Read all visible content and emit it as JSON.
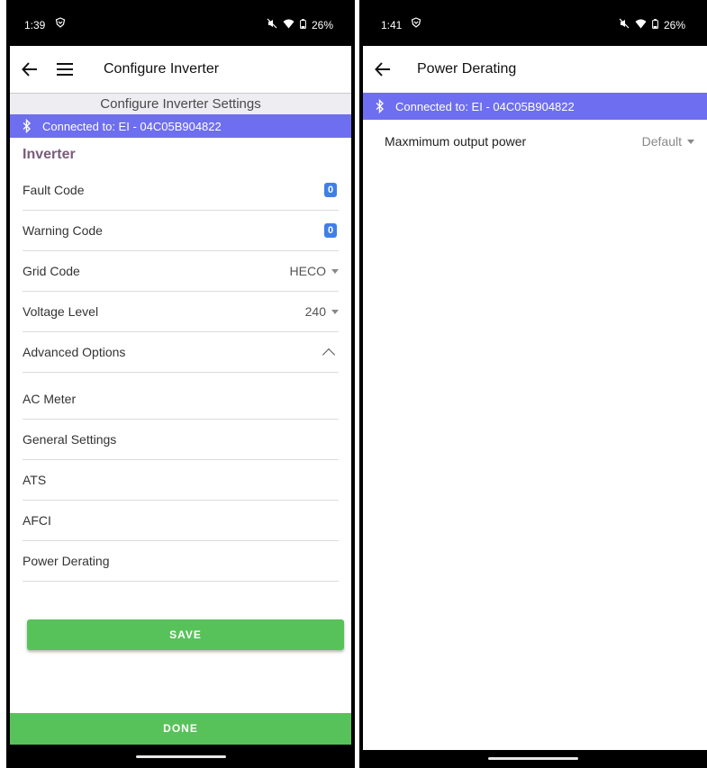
{
  "left": {
    "status": {
      "time": "1:39",
      "battery": "26%"
    },
    "appbar": {
      "title": "Configure Inverter"
    },
    "subtitle": "Configure Inverter Settings",
    "connected": "Connected to: EI - 04C05B904822",
    "section_title": "Inverter",
    "rows": {
      "fault_code": {
        "label": "Fault Code",
        "value": "0"
      },
      "warning_code": {
        "label": "Warning Code",
        "value": "0"
      },
      "grid_code": {
        "label": "Grid Code",
        "value": "HECO"
      },
      "voltage_level": {
        "label": "Voltage Level",
        "value": "240"
      },
      "advanced_options": {
        "label": "Advanced Options"
      }
    },
    "options": [
      "AC Meter",
      "General Settings",
      "ATS",
      "AFCI",
      "Power Derating"
    ],
    "save_label": "SAVE",
    "done_label": "DONE"
  },
  "right": {
    "status": {
      "time": "1:41",
      "battery": "26%"
    },
    "appbar": {
      "title": "Power Derating"
    },
    "connected": "Connected to: EI - 04C05B904822",
    "max_output": {
      "label": "Maxmimum output power",
      "value": "Default"
    }
  }
}
